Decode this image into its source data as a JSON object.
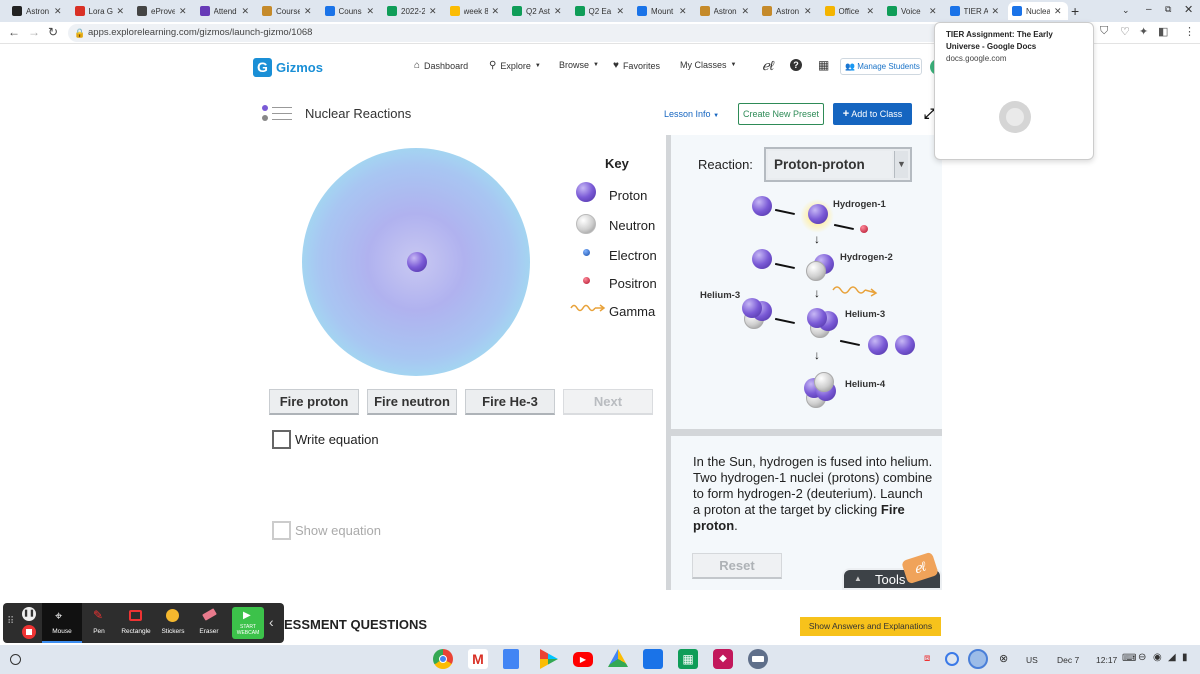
{
  "browser": {
    "tabs": [
      {
        "label": "Astron",
        "color": "#222"
      },
      {
        "label": "Lora G",
        "color": "#d93025"
      },
      {
        "label": "eProve",
        "color": "#444"
      },
      {
        "label": "Attend",
        "color": "#673ab7"
      },
      {
        "label": "Course",
        "color": "#c58a2a"
      },
      {
        "label": "Couns",
        "color": "#1a73e8"
      },
      {
        "label": "2022-2",
        "color": "#0f9d58"
      },
      {
        "label": "week 8",
        "color": "#fbbc04"
      },
      {
        "label": "Q2 Ast",
        "color": "#0f9d58"
      },
      {
        "label": "Q2 Ea",
        "color": "#0f9d58"
      },
      {
        "label": "Mount",
        "color": "#1a73e8"
      },
      {
        "label": "Astron",
        "color": "#c58a2a"
      },
      {
        "label": "Astron",
        "color": "#c58a2a"
      },
      {
        "label": "Office",
        "color": "#f4b400"
      },
      {
        "label": "Voice",
        "color": "#0f9d58"
      },
      {
        "label": "TIER A",
        "color": "#1a73e8"
      },
      {
        "label": "Nuclea",
        "color": "#1a73e8"
      }
    ],
    "url": "apps.explorelearning.com/gizmos/launch-gizmo/1068",
    "tooltip": {
      "title": "TIER Assignment: The Early Universe - Google Docs",
      "domain": "docs.google.com"
    }
  },
  "site": {
    "logo_text": "Gizmos",
    "nav": {
      "dashboard": "Dashboard",
      "explore": "Explore",
      "browse": "Browse",
      "favorites": "Favorites",
      "my_classes": "My Classes",
      "manage_students": "Manage Students"
    }
  },
  "gizmo": {
    "title": "Nuclear Reactions",
    "lesson_info": "Lesson Info",
    "create_preset": "Create New Preset",
    "add_to_class": "Add to Class",
    "key": {
      "title": "Key",
      "proton": "Proton",
      "neutron": "Neutron",
      "electron": "Electron",
      "positron": "Positron",
      "gamma": "Gamma"
    },
    "buttons": {
      "fire_proton": "Fire proton",
      "fire_neutron": "Fire neutron",
      "fire_he3": "Fire He-3",
      "next": "Next"
    },
    "write_equation": "Write equation",
    "show_equation": "Show equation",
    "reaction_label": "Reaction:",
    "reaction_value": "Proton-proton",
    "diagram_labels": {
      "h1": "Hydrogen-1",
      "h2": "Hydrogen-2",
      "he3_left": "Helium-3",
      "he3": "Helium-3",
      "he4": "Helium-4"
    },
    "description": {
      "part1": "In the Sun, hydrogen is fused into helium. Two hydrogen-1 nuclei (protons) combine to form hydrogen-2 (deuterium). Launch a proton at the target by clicking ",
      "bold": "Fire proton",
      "part2": "."
    },
    "reset": "Reset",
    "tools": "Tools",
    "assessment": "ESSMENT QUESTIONS",
    "show_answers": "Show Answers and Explanations"
  },
  "recorder": {
    "mouse": "Mouse",
    "pen": "Pen",
    "rectangle": "Rectangle",
    "stickers": "Stickers",
    "eraser": "Eraser",
    "webcam_line1": "START",
    "webcam_line2": "WEBCAM"
  },
  "system": {
    "lang": "US",
    "date": "Dec 7",
    "time": "12:17"
  },
  "colors": {
    "accent_blue": "#1565c0",
    "gizmos_blue": "#1a8fd6",
    "show_answers_yellow": "#f7c21b",
    "create_preset_green": "#2e8b57",
    "proton_purple": "#6a4bc9"
  }
}
